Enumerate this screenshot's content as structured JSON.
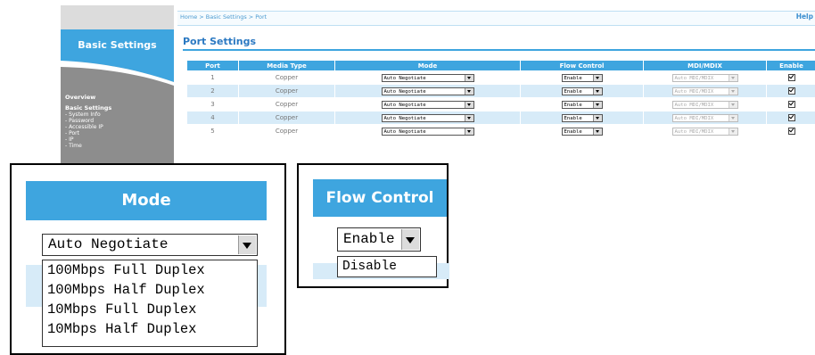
{
  "sidebar": {
    "title": "Basic Settings",
    "links": [
      {
        "label": "Overview",
        "heading": true,
        "gap_after": true
      },
      {
        "label": "Basic Settings",
        "heading": true,
        "gap_after": false
      },
      {
        "label": "- System Info",
        "heading": false,
        "gap_after": false
      },
      {
        "label": "- Password",
        "heading": false,
        "gap_after": false
      },
      {
        "label": "- Accessible IP",
        "heading": false,
        "gap_after": false
      },
      {
        "label": "- Port",
        "heading": false,
        "gap_after": false
      },
      {
        "label": "- IP",
        "heading": false,
        "gap_after": false
      },
      {
        "label": "- Time",
        "heading": false,
        "gap_after": false
      }
    ]
  },
  "header": {
    "breadcrumb": "Home > Basic Settings > Port",
    "help": "Help"
  },
  "main": {
    "title": "Port Settings",
    "columns": [
      "Port",
      "Media Type",
      "Mode",
      "Flow Control",
      "MDI/MDIX",
      "Enable"
    ],
    "rows": [
      {
        "port": "1",
        "media": "Copper",
        "mode": "Auto Negotiate",
        "flow": "Enable",
        "mdi": "Auto MDI/MDIX",
        "enabled": true
      },
      {
        "port": "2",
        "media": "Copper",
        "mode": "Auto Negotiate",
        "flow": "Enable",
        "mdi": "Auto MDI/MDIX",
        "enabled": true
      },
      {
        "port": "3",
        "media": "Copper",
        "mode": "Auto Negotiate",
        "flow": "Enable",
        "mdi": "Auto MDI/MDIX",
        "enabled": true
      },
      {
        "port": "4",
        "media": "Copper",
        "mode": "Auto Negotiate",
        "flow": "Enable",
        "mdi": "Auto MDI/MDIX",
        "enabled": true
      },
      {
        "port": "5",
        "media": "Copper",
        "mode": "Auto Negotiate",
        "flow": "Enable",
        "mdi": "Auto MDI/MDIX",
        "enabled": true
      }
    ]
  },
  "mode_callout": {
    "header": "Mode",
    "selected": "Auto Negotiate",
    "options": [
      "100Mbps Full Duplex",
      "100Mbps Half Duplex",
      "10Mbps Full Duplex",
      "10Mbps Half Duplex"
    ]
  },
  "flow_callout": {
    "header": "Flow Control",
    "selected": "Enable",
    "options": [
      "Disable"
    ]
  },
  "colors": {
    "accent": "#3ea5df",
    "row_stripe": "#d7ebf8",
    "sidebar_gray": "#8d8d8d",
    "title_blue": "#2b79c2"
  },
  "icons": {
    "dropdown": "chevron-down-icon",
    "enable": "checkbox-checked-icon",
    "sidebar_decoration": "swoosh-graphic"
  }
}
